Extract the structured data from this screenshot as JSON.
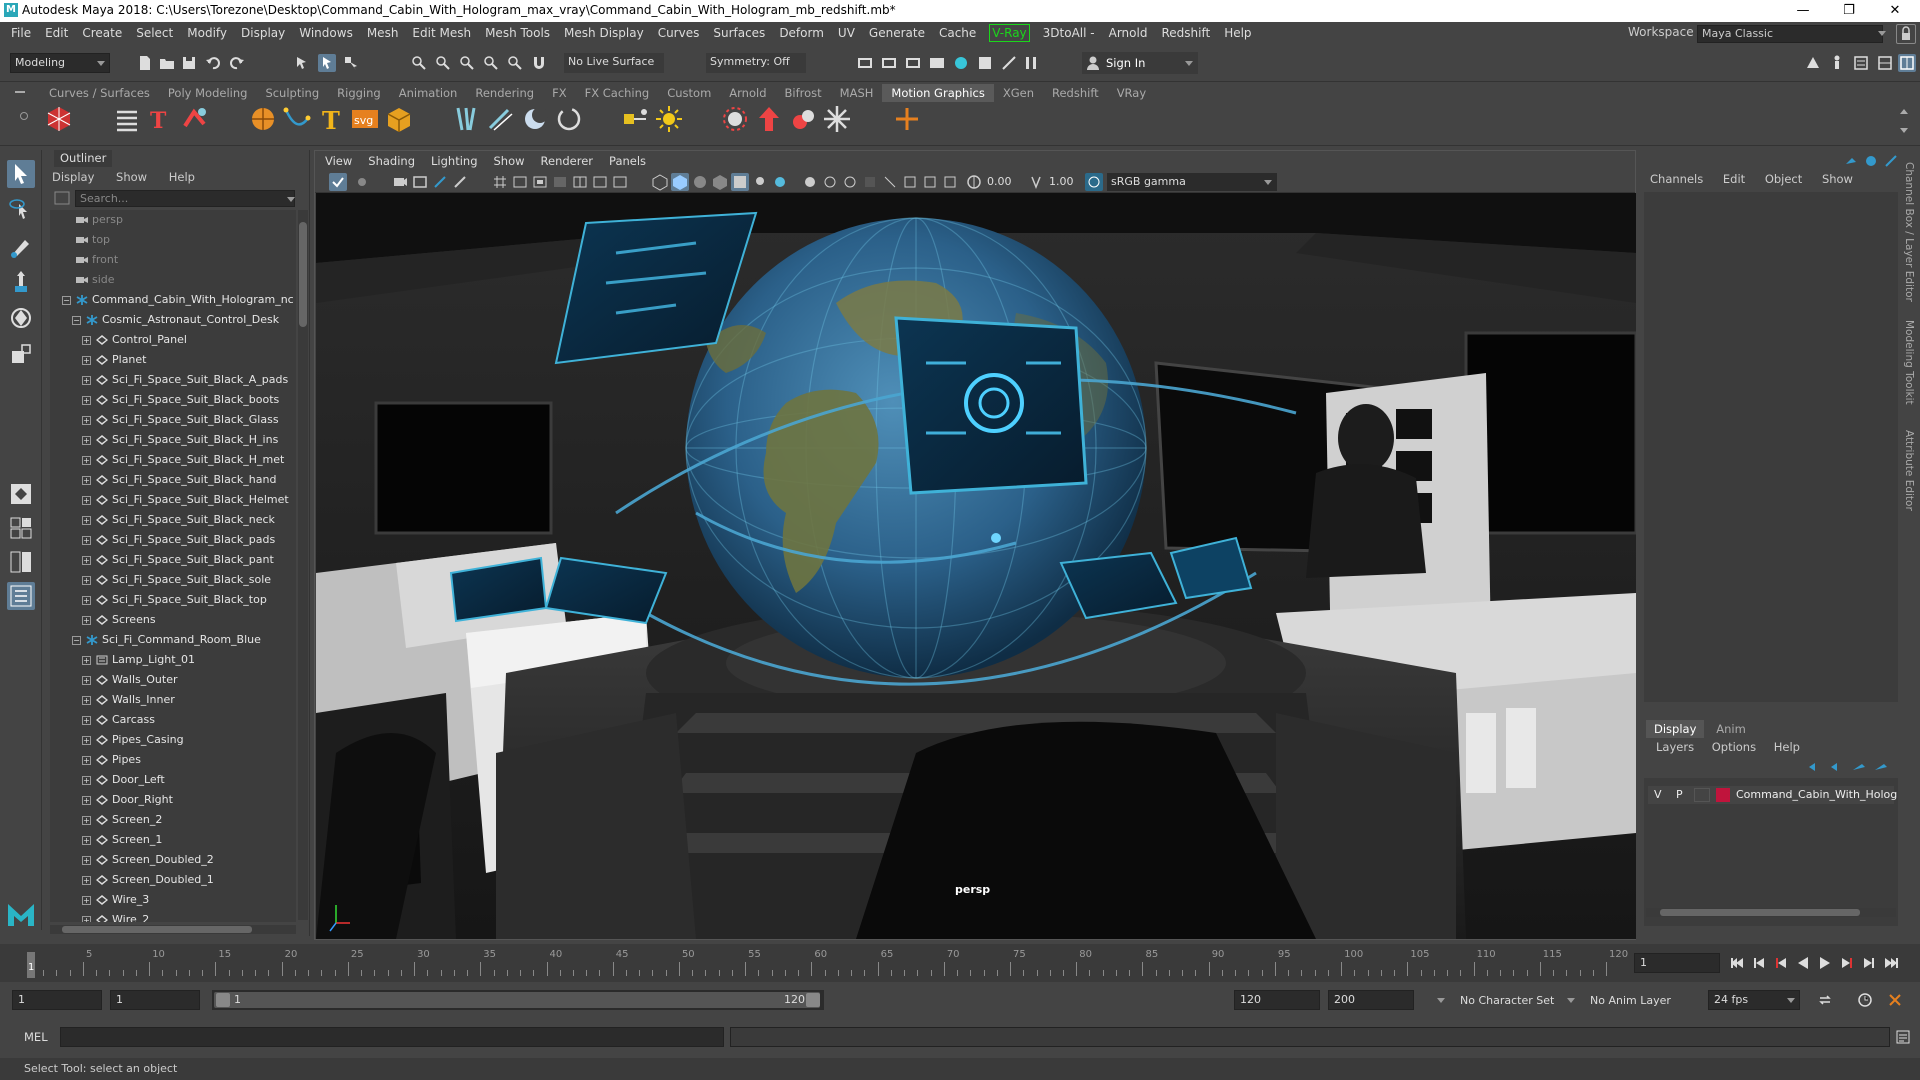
{
  "window": {
    "title": "Autodesk Maya 2018: C:\\Users\\Torezone\\Desktop\\Command_Cabin_With_Hologram_max_vray\\Command_Cabin_With_Hologram_mb_redshift.mb*",
    "minimize": "—",
    "maximize": "❐",
    "close": "✕"
  },
  "menubar": {
    "items": [
      "File",
      "Edit",
      "Create",
      "Select",
      "Modify",
      "Display",
      "Windows",
      "Mesh",
      "Edit Mesh",
      "Mesh Tools",
      "Mesh Display",
      "Curves",
      "Surfaces",
      "Deform",
      "UV",
      "Generate",
      "Cache"
    ],
    "vray": "V-Ray",
    "items2": [
      "3DtoAll -",
      "Arnold",
      "Redshift",
      "Help"
    ],
    "workspace_label": "Workspace :",
    "workspace_value": "Maya Classic"
  },
  "statusline": {
    "mode": "Modeling",
    "live_surface": "No Live Surface",
    "symmetry": "Symmetry: Off",
    "sign_in": "Sign In"
  },
  "shelf_tabs": {
    "items": [
      "Curves / Surfaces",
      "Poly Modeling",
      "Sculpting",
      "Rigging",
      "Animation",
      "Rendering",
      "FX",
      "FX Caching",
      "Custom",
      "Arnold",
      "Bifrost",
      "MASH",
      "Motion Graphics",
      "XGen",
      "Redshift",
      "VRay"
    ],
    "active": "Motion Graphics"
  },
  "outliner": {
    "title": "Outliner",
    "menu": [
      "Display",
      "Show",
      "Help"
    ],
    "search_placeholder": "Search...",
    "rows": [
      {
        "label": "persp",
        "depth": 0,
        "type": "cam"
      },
      {
        "label": "top",
        "depth": 0,
        "type": "cam"
      },
      {
        "label": "front",
        "depth": 0,
        "type": "cam"
      },
      {
        "label": "side",
        "depth": 0,
        "type": "cam"
      },
      {
        "label": "Command_Cabin_With_Hologram_nc",
        "depth": 0,
        "type": "group",
        "exp": "−"
      },
      {
        "label": "Cosmic_Astronaut_Control_Desk",
        "depth": 1,
        "type": "group",
        "exp": "−"
      },
      {
        "label": "Control_Panel",
        "depth": 2,
        "type": "mesh",
        "exp": "+"
      },
      {
        "label": "Planet",
        "depth": 2,
        "type": "mesh",
        "exp": "+"
      },
      {
        "label": "Sci_Fi_Space_Suit_Black_A_pads",
        "depth": 2,
        "type": "mesh",
        "exp": "+"
      },
      {
        "label": "Sci_Fi_Space_Suit_Black_boots",
        "depth": 2,
        "type": "mesh",
        "exp": "+"
      },
      {
        "label": "Sci_Fi_Space_Suit_Black_Glass",
        "depth": 2,
        "type": "mesh",
        "exp": "+"
      },
      {
        "label": "Sci_Fi_Space_Suit_Black_H_ins",
        "depth": 2,
        "type": "mesh",
        "exp": "+"
      },
      {
        "label": "Sci_Fi_Space_Suit_Black_H_met",
        "depth": 2,
        "type": "mesh",
        "exp": "+"
      },
      {
        "label": "Sci_Fi_Space_Suit_Black_hand",
        "depth": 2,
        "type": "mesh",
        "exp": "+"
      },
      {
        "label": "Sci_Fi_Space_Suit_Black_Helmet",
        "depth": 2,
        "type": "mesh",
        "exp": "+"
      },
      {
        "label": "Sci_Fi_Space_Suit_Black_neck",
        "depth": 2,
        "type": "mesh",
        "exp": "+"
      },
      {
        "label": "Sci_Fi_Space_Suit_Black_pads",
        "depth": 2,
        "type": "mesh",
        "exp": "+"
      },
      {
        "label": "Sci_Fi_Space_Suit_Black_pant",
        "depth": 2,
        "type": "mesh",
        "exp": "+"
      },
      {
        "label": "Sci_Fi_Space_Suit_Black_sole",
        "depth": 2,
        "type": "mesh",
        "exp": "+"
      },
      {
        "label": "Sci_Fi_Space_Suit_Black_top",
        "depth": 2,
        "type": "mesh",
        "exp": "+"
      },
      {
        "label": "Screens",
        "depth": 2,
        "type": "mesh",
        "exp": "+"
      },
      {
        "label": "Sci_Fi_Command_Room_Blue",
        "depth": 1,
        "type": "group",
        "exp": "−"
      },
      {
        "label": "Lamp_Light_01",
        "depth": 2,
        "type": "light",
        "exp": "+"
      },
      {
        "label": "Walls_Outer",
        "depth": 2,
        "type": "mesh",
        "exp": "+"
      },
      {
        "label": "Walls_Inner",
        "depth": 2,
        "type": "mesh",
        "exp": "+"
      },
      {
        "label": "Carcass",
        "depth": 2,
        "type": "mesh",
        "exp": "+"
      },
      {
        "label": "Pipes_Casing",
        "depth": 2,
        "type": "mesh",
        "exp": "+"
      },
      {
        "label": "Pipes",
        "depth": 2,
        "type": "mesh",
        "exp": "+"
      },
      {
        "label": "Door_Left",
        "depth": 2,
        "type": "mesh",
        "exp": "+"
      },
      {
        "label": "Door_Right",
        "depth": 2,
        "type": "mesh",
        "exp": "+"
      },
      {
        "label": "Screen_2",
        "depth": 2,
        "type": "mesh",
        "exp": "+"
      },
      {
        "label": "Screen_1",
        "depth": 2,
        "type": "mesh",
        "exp": "+"
      },
      {
        "label": "Screen_Doubled_2",
        "depth": 2,
        "type": "mesh",
        "exp": "+"
      },
      {
        "label": "Screen_Doubled_1",
        "depth": 2,
        "type": "mesh",
        "exp": "+"
      },
      {
        "label": "Wire_3",
        "depth": 2,
        "type": "mesh",
        "exp": "+"
      },
      {
        "label": "Wire_2",
        "depth": 2,
        "type": "mesh",
        "exp": "+"
      }
    ]
  },
  "viewport": {
    "menu": [
      "View",
      "Shading",
      "Lighting",
      "Show",
      "Renderer",
      "Panels"
    ],
    "exposure": "0.00",
    "gamma": "1.00",
    "colorspace": "sRGB gamma",
    "camera_label": "persp"
  },
  "channelbox": {
    "menu": [
      "Channels",
      "Edit",
      "Object",
      "Show"
    ],
    "side_tabs": [
      "Channel Box / Layer Editor",
      "Modeling Toolkit",
      "Attribute Editor"
    ]
  },
  "layer_editor": {
    "tabs": [
      "Display",
      "Anim"
    ],
    "active_tab": "Display",
    "menu": [
      "Layers",
      "Options",
      "Help"
    ],
    "layer": {
      "v": "V",
      "p": "P",
      "name": "Command_Cabin_With_Holog",
      "color": "#c0143c"
    }
  },
  "timeline": {
    "start": 1,
    "end": 120,
    "major_ticks": [
      5,
      10,
      15,
      20,
      25,
      30,
      35,
      40,
      45,
      50,
      55,
      60,
      65,
      70,
      75,
      80,
      85,
      90,
      95,
      100,
      105,
      110,
      115,
      120
    ],
    "current_frame": "1",
    "current_marker": 1
  },
  "range": {
    "start_field": "1",
    "playback_start": "1",
    "slider_start": "1",
    "slider_end": "120",
    "playback_end": "120",
    "end_field": "200",
    "character_set": "No Character Set",
    "anim_layer": "No Anim Layer",
    "fps": "24 fps"
  },
  "cmdline": {
    "label": "MEL"
  },
  "helpline": {
    "text": "Select Tool: select an object"
  }
}
